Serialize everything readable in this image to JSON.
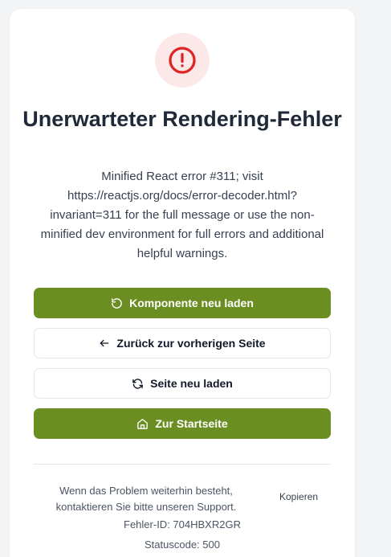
{
  "error": {
    "title": "Unerwarteter Rendering-Fehler",
    "message": "Minified React error #311; visit https://reactjs.org/docs/error-decoder.html?invariant=311 for the full message or use the non-minified dev environment for full errors and additional helpful warnings.",
    "icon": "alert-circle-icon"
  },
  "actions": {
    "reload_component": "Komponente neu laden",
    "go_back": "Zurück zur vorherigen Seite",
    "reload_page": "Seite neu laden",
    "home": "Zur Startseite"
  },
  "support": {
    "text": "Wenn das Problem weiterhin besteht, kontaktieren Sie bitte unseren Support.",
    "copy_label": "Kopieren",
    "error_id": "Fehler-ID: 704HBXR2GR",
    "status_code": "Statuscode: 500"
  },
  "colors": {
    "accent": "#6b8e23",
    "error": "#dc2626",
    "error_bg": "#fce8e8"
  }
}
